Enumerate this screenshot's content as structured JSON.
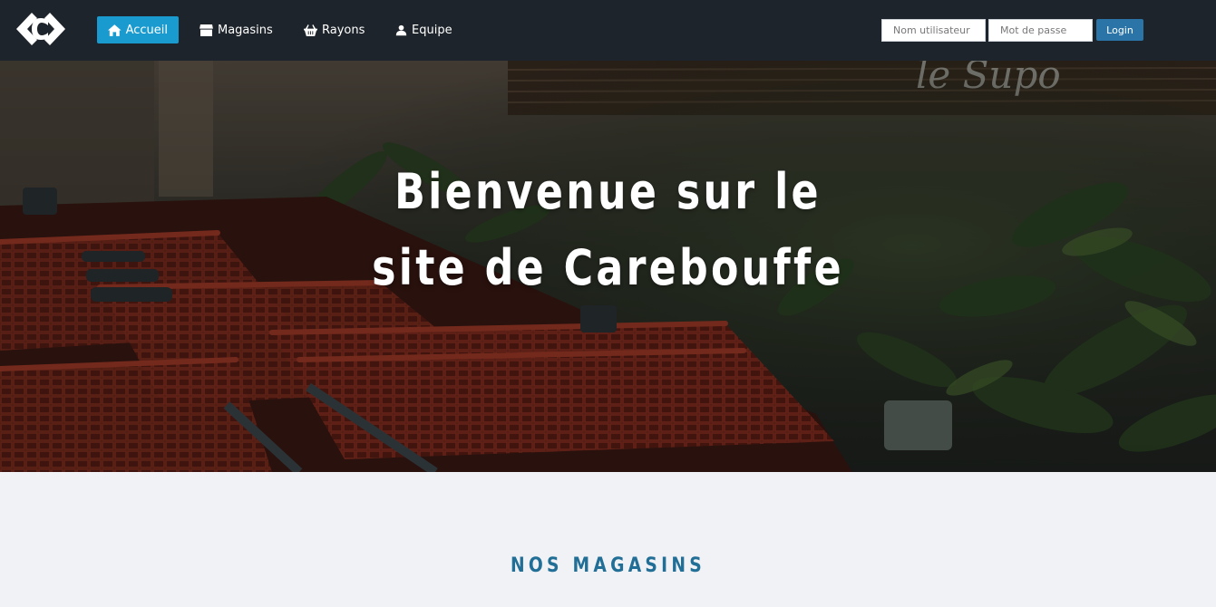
{
  "nav": {
    "logo_icon": "carrefour-logo",
    "items": [
      {
        "label": "Accueil",
        "icon": "home-icon",
        "active": true
      },
      {
        "label": "Magasins",
        "icon": "store-icon",
        "active": false
      },
      {
        "label": "Rayons",
        "icon": "basket-icon",
        "active": false
      },
      {
        "label": "Equipe",
        "icon": "user-icon",
        "active": false
      }
    ]
  },
  "login": {
    "username_placeholder": "Nom utilisateur",
    "username_value": "",
    "password_placeholder": "Mot de passe",
    "password_value": "",
    "button_label": "Login"
  },
  "hero": {
    "title_line1": "Bienvenue sur le",
    "title_line2": "site de Carebouffe"
  },
  "section": {
    "title": "NOS MAGASINS"
  },
  "colors": {
    "navbar_bg": "#1e242b",
    "active_nav": "#1a9bd0",
    "login_button": "#2b74a8",
    "section_title": "#216e96",
    "page_bg": "#f1f2f5"
  }
}
